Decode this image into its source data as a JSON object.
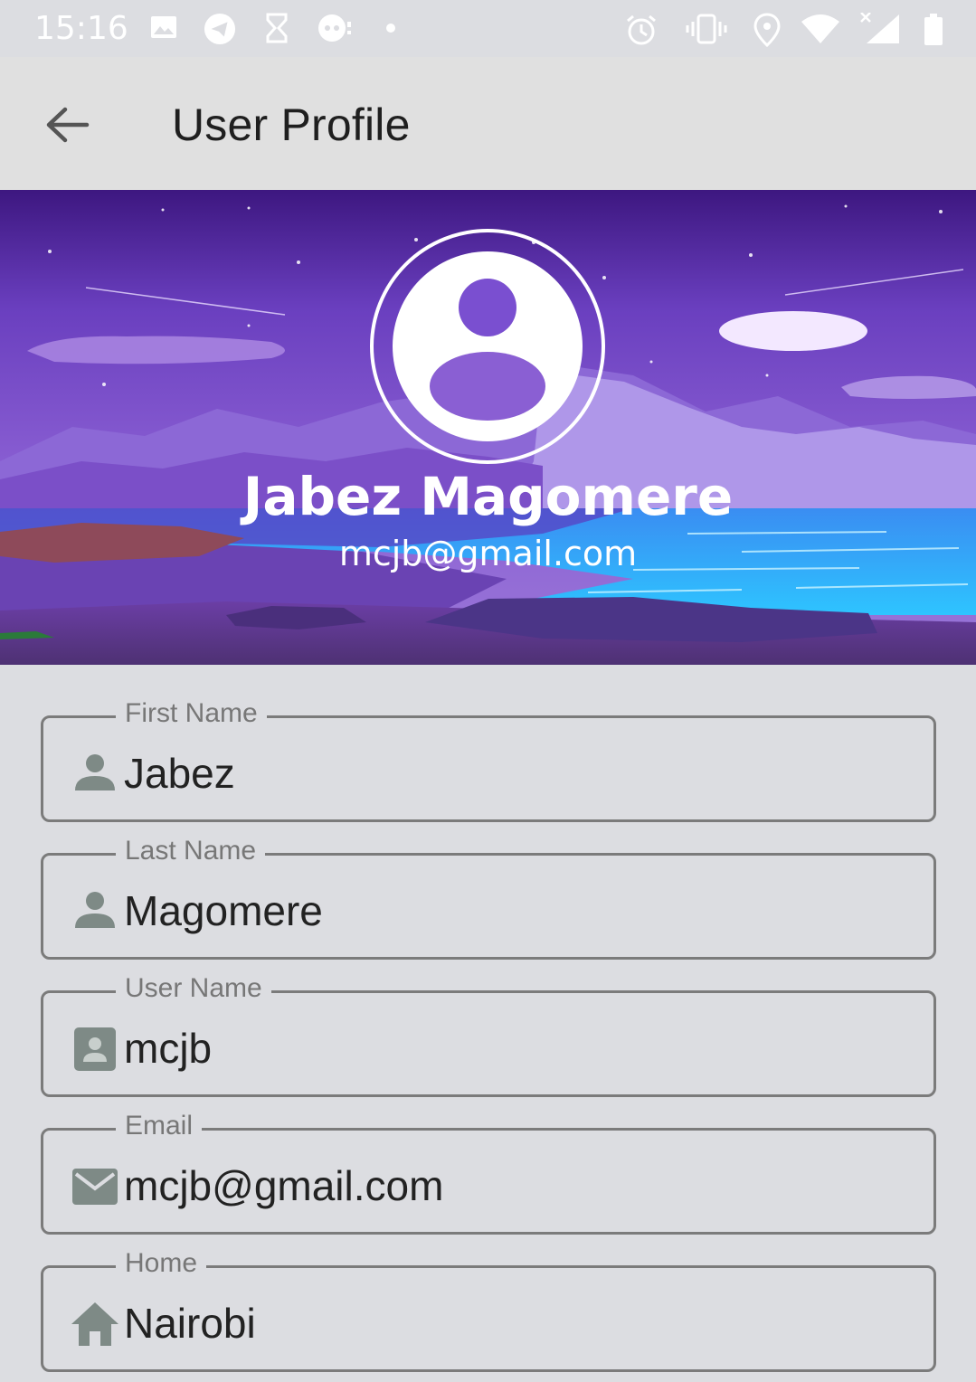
{
  "status_bar": {
    "time": "15:16",
    "left_icons": [
      "image-icon",
      "telegram-icon",
      "hourglass-icon",
      "chat-icon",
      "dot-icon"
    ],
    "right_icons": [
      "alarm-icon",
      "vibrate-icon",
      "location-icon",
      "wifi-icon",
      "signal-icon",
      "battery-icon"
    ]
  },
  "app_bar": {
    "back_icon": "arrow-back-icon",
    "title": "User Profile"
  },
  "profile": {
    "name": "Jabez Magomere",
    "email": "mcjb@gmail.com"
  },
  "fields": [
    {
      "label": "First Name",
      "value": "Jabez",
      "icon": "person-icon"
    },
    {
      "label": "Last Name",
      "value": "Magomere",
      "icon": "person-icon"
    },
    {
      "label": "User Name",
      "value": "mcjb",
      "icon": "account-box-icon"
    },
    {
      "label": "Email",
      "value": "mcjb@gmail.com",
      "icon": "mail-icon"
    },
    {
      "label": "Home",
      "value": "Nairobi",
      "icon": "home-icon"
    }
  ],
  "colors": {
    "background": "#dcdde1",
    "app_bar": "#e0e0e0",
    "banner_purple": "#6a3fbf",
    "icon_grey": "#7e8a86",
    "outline": "#7b7b7b"
  }
}
